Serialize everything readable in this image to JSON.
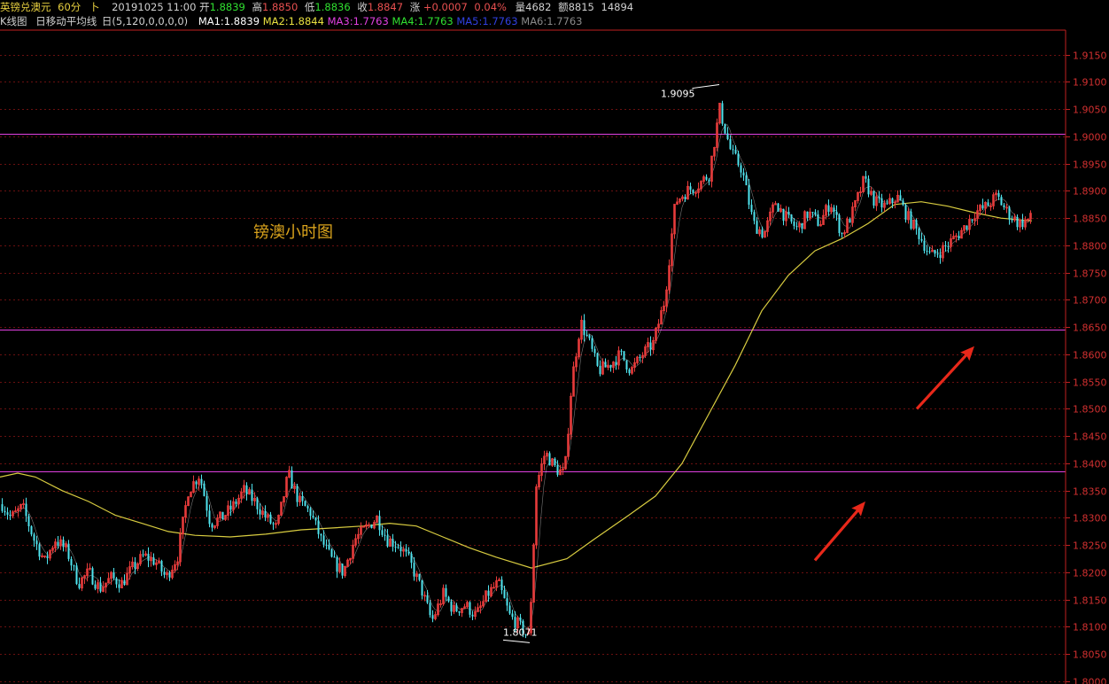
{
  "header": {
    "pair": "英镑兑澳元",
    "period": "60分",
    "direction": "卜",
    "datetime": "20191025 11:00",
    "open_label": "开",
    "open": "1.8839",
    "high_label": "高",
    "high": "1.8850",
    "low_label": "低",
    "low": "1.8836",
    "close_label": "收",
    "close": "1.8847",
    "change_label": "涨",
    "change": "+0.0007",
    "change_pct": "0.04%",
    "volume_label": "量",
    "volume": "4682",
    "amount_label": "额",
    "amount": "8815",
    "extra": "14894"
  },
  "ma_bar": {
    "kline_label": "K线图",
    "indicator_label": "日移动平均线",
    "params": "日(5,120,0,0,0,0)",
    "ma1": "MA1:1.8839",
    "ma2": "MA2:1.8844",
    "ma3": "MA3:1.7763",
    "ma4": "MA4:1.7763",
    "ma5": "MA5:1.7763",
    "ma6": "MA6:1.7763"
  },
  "colors": {
    "background": "#000000",
    "up_candle": "#e63b3b",
    "down_candle": "#4fe3ee",
    "ma_long": "#d8cc40",
    "hline": "#e040e0",
    "grid": "#6a1010",
    "axis": "#c02020",
    "arrow": "#e8281a",
    "caption": "#d8a21c",
    "ma1": "#ffffff",
    "ma2": "#e8e040",
    "ma3": "#e040e0",
    "ma4": "#30e030",
    "ma5": "#3040e0",
    "ma6": "#8a8a8a"
  },
  "chart_data": {
    "type": "candlestick",
    "caption": "镑澳小时图",
    "ylim": [
      1.8,
      1.9195
    ],
    "y_ticks": [
      "1.9150",
      "1.9100",
      "1.9050",
      "1.9000",
      "1.8950",
      "1.8900",
      "1.8850",
      "1.8800",
      "1.8750",
      "1.8700",
      "1.8650",
      "1.8600",
      "1.8550",
      "1.8500",
      "1.8450",
      "1.8400",
      "1.8350",
      "1.8300",
      "1.8250",
      "1.8200",
      "1.8150",
      "1.8100",
      "1.8050",
      "1.8000"
    ],
    "horizontal_lines": [
      1.9005,
      1.8645,
      1.8385
    ],
    "annotations": [
      {
        "label": "1.9095",
        "value": 1.9095,
        "type": "high"
      },
      {
        "label": "1.8071",
        "value": 1.8071,
        "type": "low"
      }
    ],
    "price_path": [
      [
        0,
        1.833
      ],
      [
        12,
        1.83
      ],
      [
        25,
        1.832
      ],
      [
        38,
        1.826
      ],
      [
        50,
        1.822
      ],
      [
        62,
        1.826
      ],
      [
        75,
        1.824
      ],
      [
        88,
        1.818
      ],
      [
        100,
        1.82
      ],
      [
        112,
        1.817
      ],
      [
        125,
        1.819
      ],
      [
        137,
        1.818
      ],
      [
        150,
        1.821
      ],
      [
        162,
        1.823
      ],
      [
        175,
        1.822
      ],
      [
        187,
        1.819
      ],
      [
        200,
        1.823
      ],
      [
        212,
        1.835
      ],
      [
        225,
        1.838
      ],
      [
        237,
        1.829
      ],
      [
        250,
        1.83
      ],
      [
        262,
        1.832
      ],
      [
        275,
        1.835
      ],
      [
        287,
        1.833
      ],
      [
        300,
        1.83
      ],
      [
        312,
        1.828
      ],
      [
        325,
        1.838
      ],
      [
        337,
        1.833
      ],
      [
        350,
        1.831
      ],
      [
        362,
        1.826
      ],
      [
        375,
        1.822
      ],
      [
        387,
        1.82
      ],
      [
        400,
        1.826
      ],
      [
        412,
        1.828
      ],
      [
        425,
        1.83
      ],
      [
        437,
        1.826
      ],
      [
        450,
        1.825
      ],
      [
        462,
        1.822
      ],
      [
        475,
        1.817
      ],
      [
        487,
        1.811
      ],
      [
        500,
        1.816
      ],
      [
        512,
        1.813
      ],
      [
        525,
        1.814
      ],
      [
        537,
        1.812
      ],
      [
        550,
        1.816
      ],
      [
        562,
        1.818
      ],
      [
        575,
        1.812
      ],
      [
        587,
        1.81
      ],
      [
        597,
        1.808
      ],
      [
        605,
        1.836
      ],
      [
        615,
        1.842
      ],
      [
        627,
        1.839
      ],
      [
        637,
        1.838
      ],
      [
        645,
        1.855
      ],
      [
        655,
        1.866
      ],
      [
        665,
        1.862
      ],
      [
        675,
        1.857
      ],
      [
        687,
        1.858
      ],
      [
        700,
        1.86
      ],
      [
        712,
        1.857
      ],
      [
        725,
        1.86
      ],
      [
        737,
        1.862
      ],
      [
        750,
        1.87
      ],
      [
        762,
        1.888
      ],
      [
        775,
        1.89
      ],
      [
        787,
        1.891
      ],
      [
        800,
        1.893
      ],
      [
        812,
        1.905
      ],
      [
        825,
        1.897
      ],
      [
        837,
        1.894
      ],
      [
        850,
        1.884
      ],
      [
        862,
        1.882
      ],
      [
        875,
        1.888
      ],
      [
        887,
        1.885
      ],
      [
        900,
        1.883
      ],
      [
        912,
        1.886
      ],
      [
        925,
        1.884
      ],
      [
        937,
        1.888
      ],
      [
        950,
        1.882
      ],
      [
        962,
        1.886
      ],
      [
        975,
        1.892
      ],
      [
        987,
        1.888
      ],
      [
        1000,
        1.887
      ],
      [
        1012,
        1.889
      ],
      [
        1025,
        1.885
      ],
      [
        1037,
        1.882
      ],
      [
        1050,
        1.878
      ],
      [
        1062,
        1.879
      ],
      [
        1075,
        1.881
      ],
      [
        1087,
        1.883
      ],
      [
        1100,
        1.886
      ],
      [
        1112,
        1.887
      ],
      [
        1125,
        1.889
      ],
      [
        1137,
        1.886
      ],
      [
        1150,
        1.884
      ],
      [
        1165,
        1.885
      ]
    ],
    "ma_long": [
      [
        0,
        1.8375
      ],
      [
        20,
        1.8382
      ],
      [
        40,
        1.8375
      ],
      [
        70,
        1.835
      ],
      [
        100,
        1.833
      ],
      [
        130,
        1.8305
      ],
      [
        160,
        1.829
      ],
      [
        190,
        1.8275
      ],
      [
        220,
        1.8268
      ],
      [
        260,
        1.8265
      ],
      [
        300,
        1.827
      ],
      [
        340,
        1.8278
      ],
      [
        380,
        1.8282
      ],
      [
        410,
        1.8285
      ],
      [
        440,
        1.829
      ],
      [
        470,
        1.8285
      ],
      [
        500,
        1.8265
      ],
      [
        530,
        1.8245
      ],
      [
        560,
        1.8228
      ],
      [
        600,
        1.8208
      ],
      [
        640,
        1.8225
      ],
      [
        670,
        1.826
      ],
      [
        710,
        1.8305
      ],
      [
        740,
        1.834
      ],
      [
        770,
        1.84
      ],
      [
        800,
        1.849
      ],
      [
        830,
        1.858
      ],
      [
        860,
        1.868
      ],
      [
        890,
        1.8745
      ],
      [
        920,
        1.879
      ],
      [
        950,
        1.8812
      ],
      [
        980,
        1.884
      ],
      [
        1010,
        1.8875
      ],
      [
        1040,
        1.888
      ],
      [
        1070,
        1.8872
      ],
      [
        1100,
        1.886
      ],
      [
        1130,
        1.885
      ],
      [
        1165,
        1.8845
      ]
    ],
    "arrows": [
      {
        "from": [
          920,
          1.8222
        ],
        "to": [
          977,
          1.833
        ]
      },
      {
        "from": [
          1035,
          1.85
        ],
        "to": [
          1100,
          1.8615
        ]
      }
    ]
  }
}
